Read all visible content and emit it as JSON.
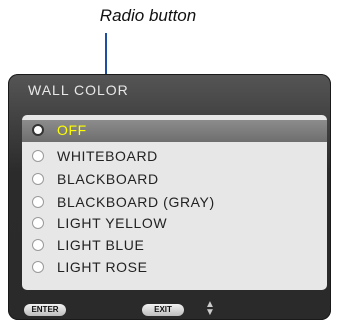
{
  "callout": {
    "label": "Radio button"
  },
  "dialog": {
    "title": "WALL COLOR",
    "options": [
      {
        "label": "OFF",
        "selected": true
      },
      {
        "label": "WHITEBOARD",
        "selected": false
      },
      {
        "label": "BLACKBOARD",
        "selected": false
      },
      {
        "label": "BLACKBOARD (GRAY)",
        "selected": false
      },
      {
        "label": "LIGHT YELLOW",
        "selected": false
      },
      {
        "label": "LIGHT BLUE",
        "selected": false
      },
      {
        "label": "LIGHT ROSE",
        "selected": false
      }
    ]
  },
  "footer": {
    "enter_label": "ENTER",
    "exit_label": "EXIT",
    "navigate_icon": "up-down-arrows-icon"
  },
  "colors": {
    "selected_text": "#ffff00",
    "callout_line": "#1f4fa0"
  }
}
